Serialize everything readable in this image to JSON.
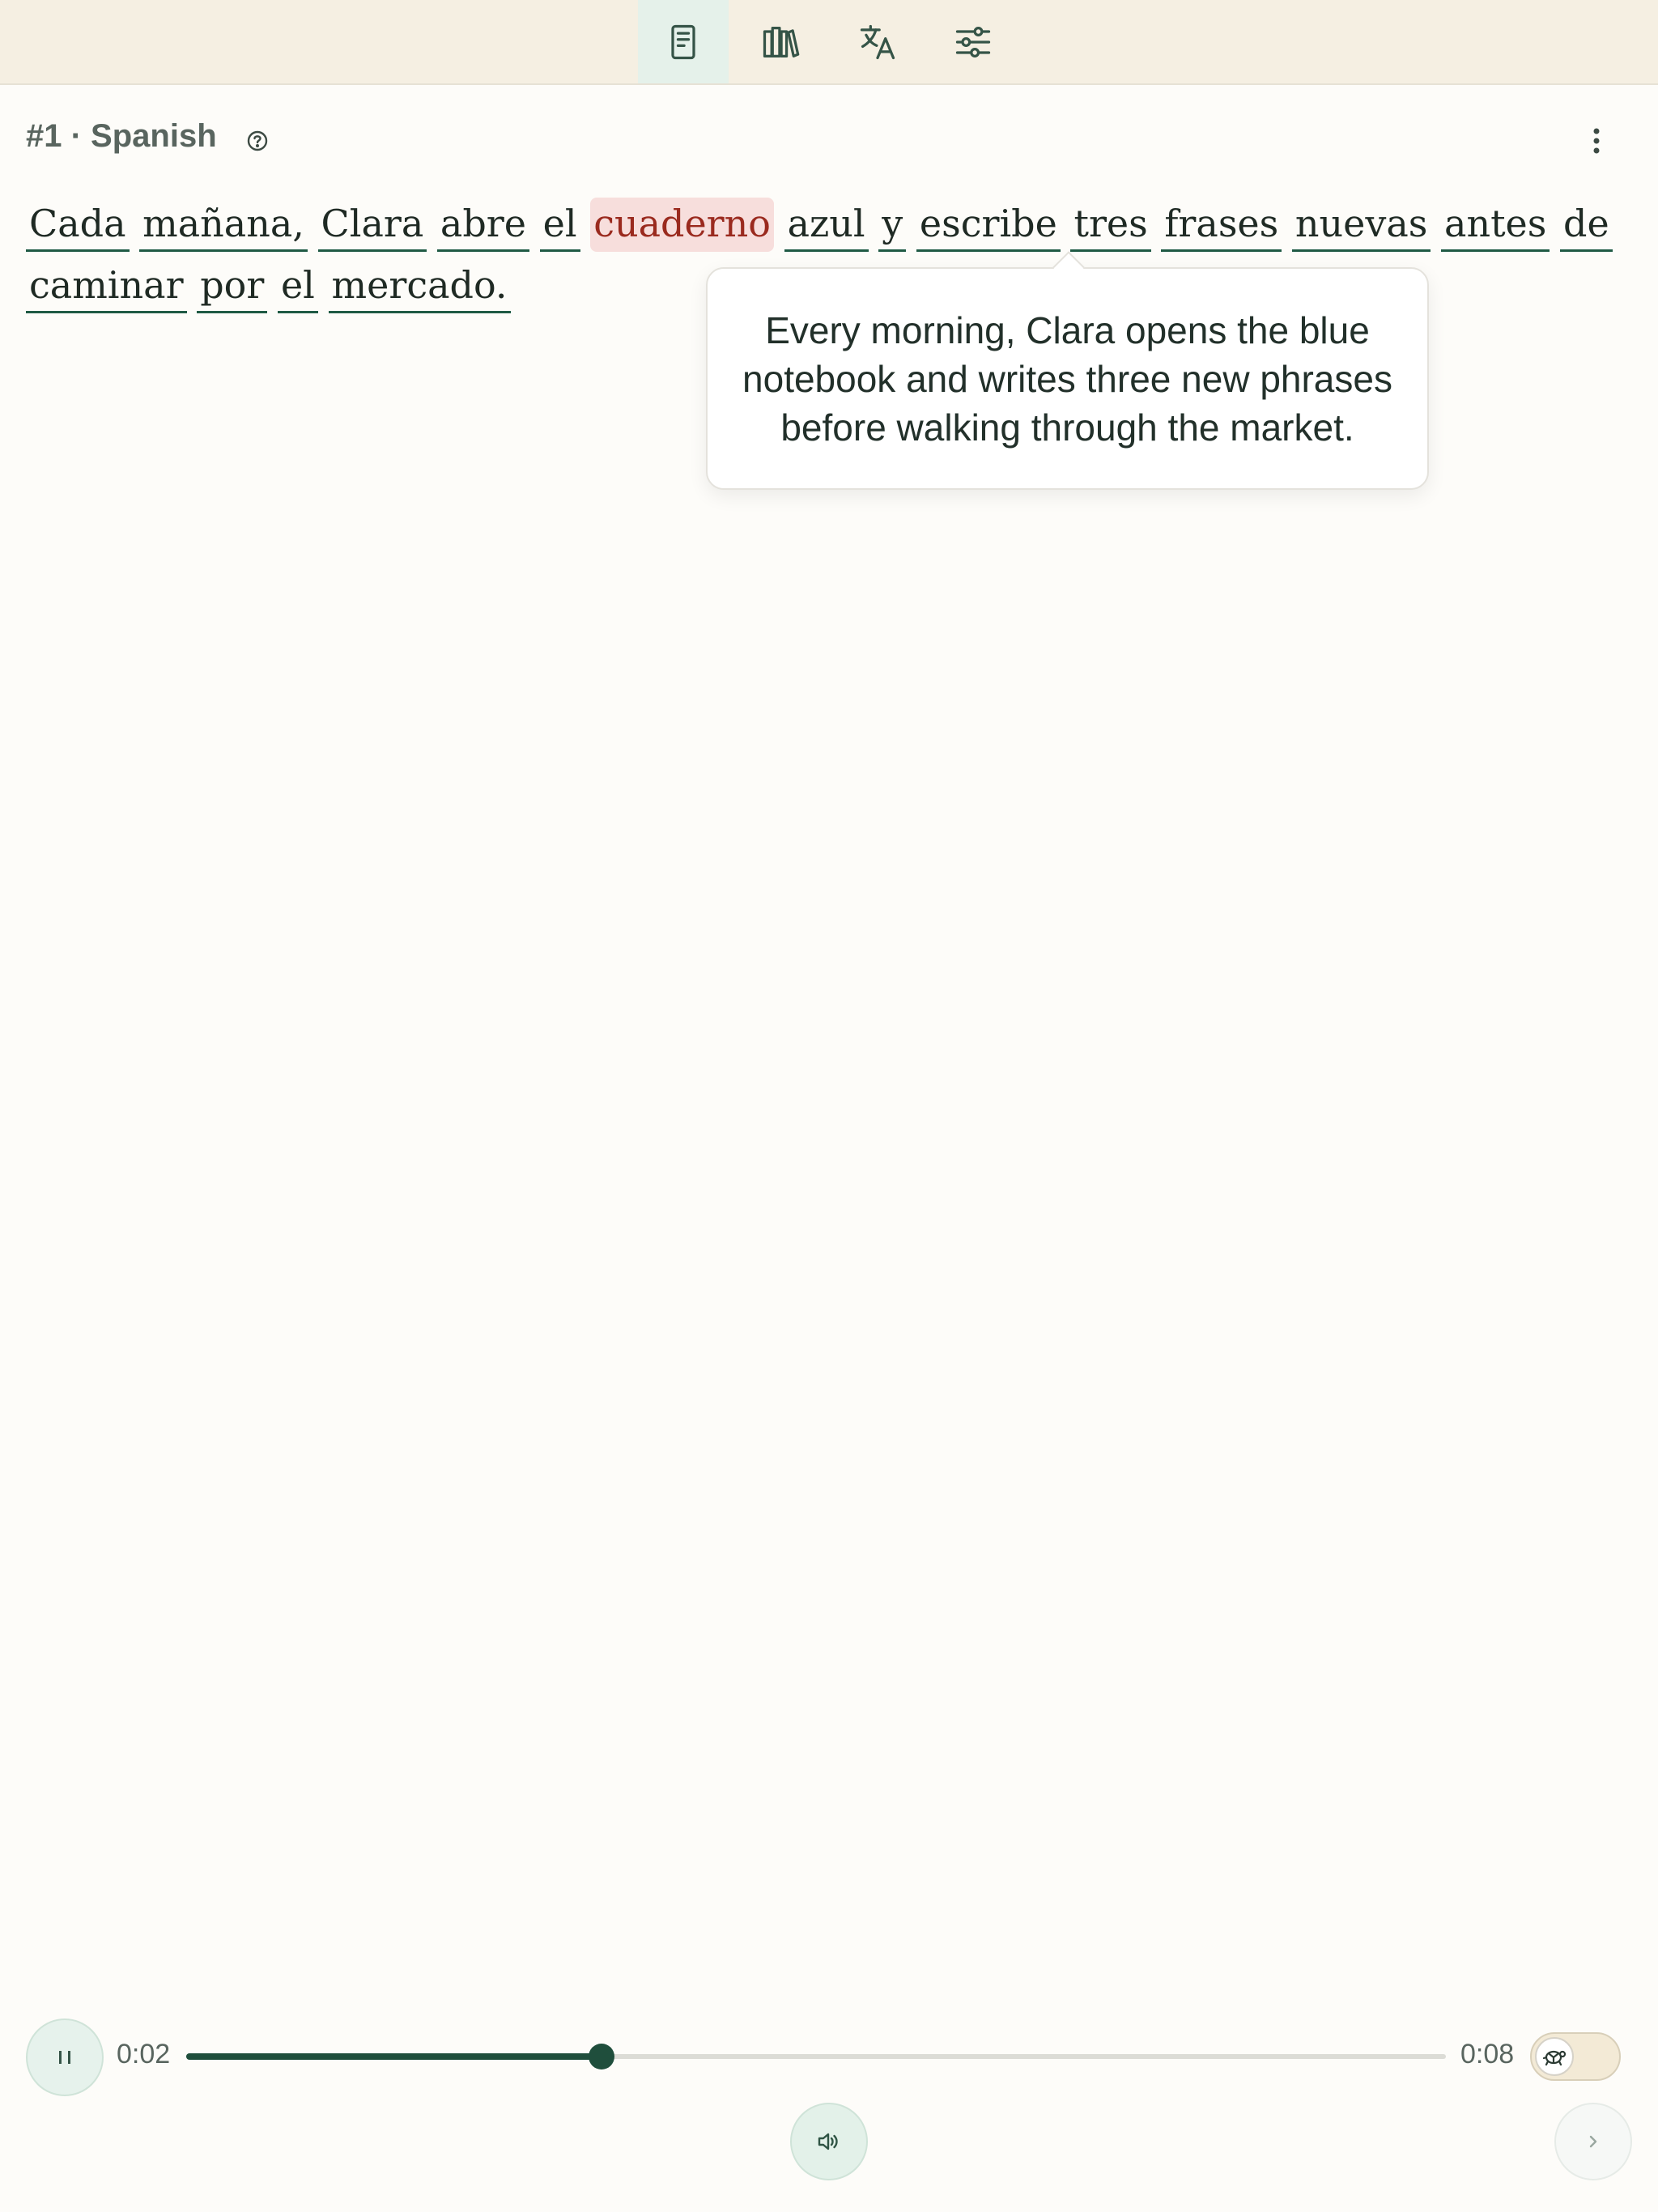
{
  "nav": {
    "tabs": [
      {
        "name": "reader",
        "icon": "book-icon",
        "active": true
      },
      {
        "name": "library",
        "icon": "library-icon",
        "active": false
      },
      {
        "name": "translate",
        "icon": "translate-icon",
        "active": false
      },
      {
        "name": "settings",
        "icon": "sliders-icon",
        "active": false
      }
    ]
  },
  "header": {
    "title": "#1 · Spanish",
    "help_icon": "question-circle-icon",
    "menu_icon": "more-vertical-icon"
  },
  "sentence": {
    "words": [
      "Cada",
      "mañana,",
      "Clara",
      "abre",
      "el",
      "cuaderno",
      "azul",
      "y",
      "escribe",
      "tres",
      "frases",
      "nuevas",
      "antes",
      "de",
      "caminar",
      "por",
      "el",
      "mercado."
    ],
    "highlighted": "cuaderno"
  },
  "translation": {
    "text": "Every morning, Clara opens the blue notebook and writes three new phrases before walking through the market."
  },
  "player": {
    "current_time": "0:02",
    "total_time": "0:08",
    "progress": 0.33,
    "state": "playing",
    "pause_icon": "pause-icon",
    "speed_icon": "turtle-icon",
    "audio_icon": "speaker-icon",
    "next_icon": "chevron-right-icon"
  },
  "colors": {
    "accent": "#1f4e3c",
    "highlight_bg": "#f7dedc",
    "highlight_text": "#9a2a1e",
    "topbar_bg": "#f5efe2"
  }
}
